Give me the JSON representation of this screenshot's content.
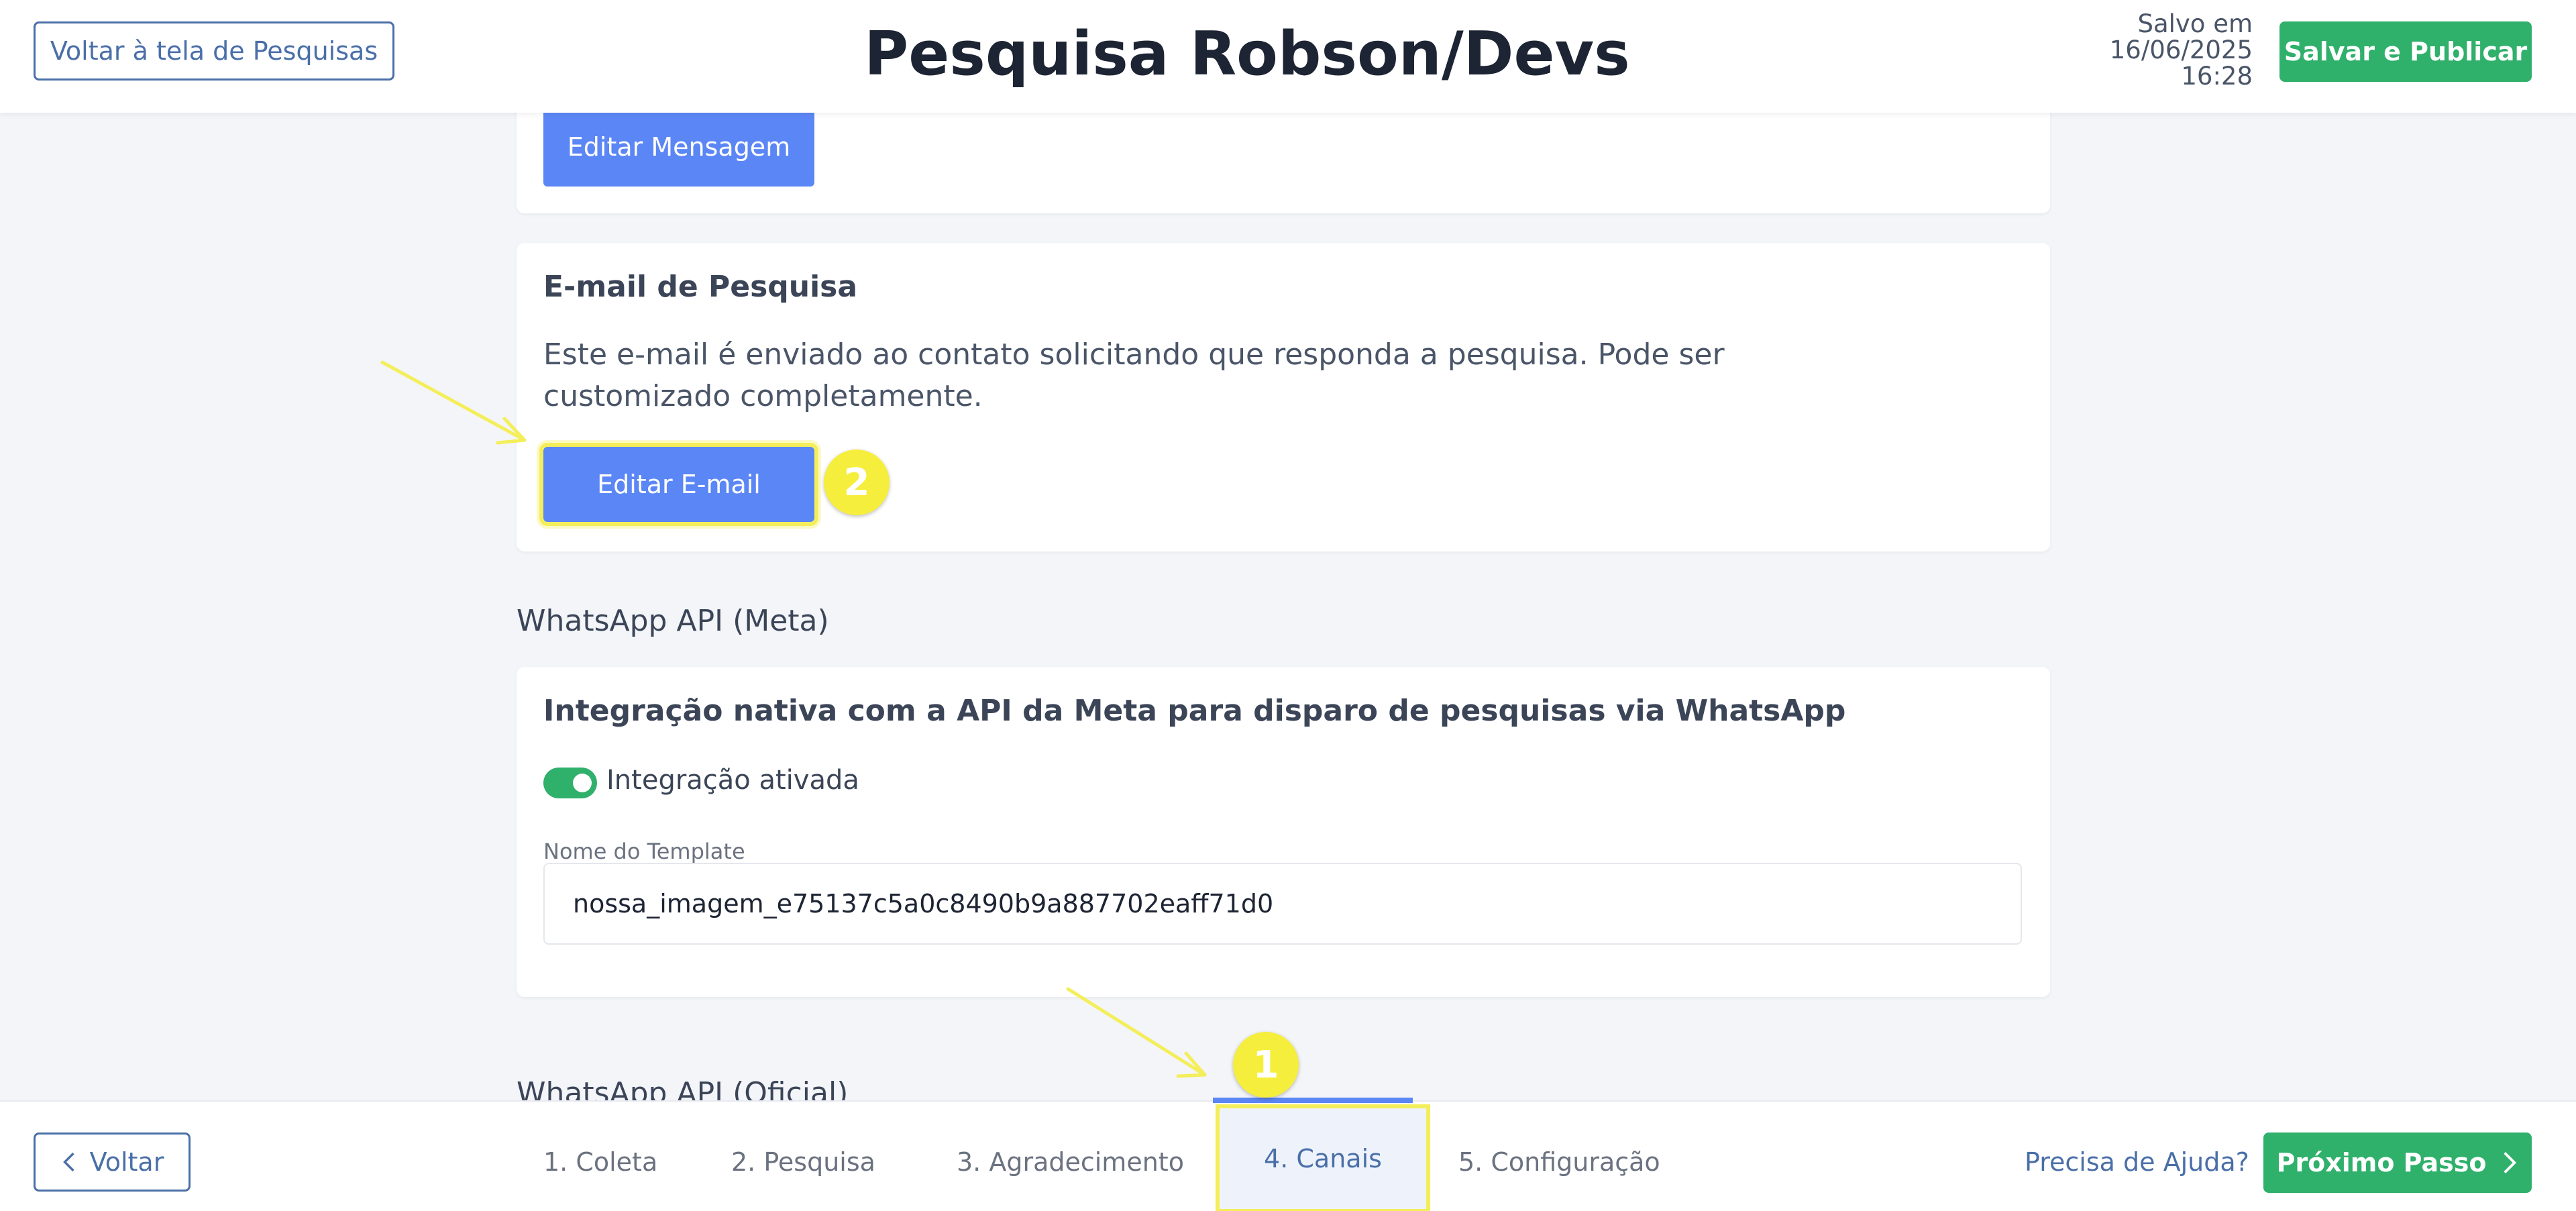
{
  "header": {
    "back_to_list_label": "Voltar à tela de Pesquisas",
    "title": "Pesquisa Robson/Devs",
    "saved_line1": "Salvo em",
    "saved_line2": "16/06/2025",
    "saved_line3": "16:28",
    "publish_label": "Salvar e Publicar"
  },
  "message_card": {
    "edit_message_label": "Editar Mensagem"
  },
  "email_card": {
    "heading": "E-mail de Pesquisa",
    "description": "Este e-mail é enviado ao contato solicitando que responda a pesquisa. Pode ser customizado completamente.",
    "edit_email_label": "Editar E-mail"
  },
  "whatsapp_meta": {
    "section_label": "WhatsApp API (Meta)",
    "heading": "Integração nativa com a API da Meta para disparo de pesquisas via WhatsApp",
    "toggle_label": "Integração ativada",
    "toggle_on": true,
    "template_field_label": "Nome do Template",
    "template_value": "nossa_imagem_e75137c5a0c8490b9a887702eaff71d0"
  },
  "whatsapp_official": {
    "section_label": "WhatsApp API (Oficial)"
  },
  "annotations": {
    "marker_1": "1",
    "marker_2": "2"
  },
  "footer": {
    "back_label": "Voltar",
    "steps": [
      {
        "label": "1. Coleta",
        "active": false
      },
      {
        "label": "2. Pesquisa",
        "active": false
      },
      {
        "label": "3. Agradecimento",
        "active": false
      },
      {
        "label": "4. Canais",
        "active": true
      },
      {
        "label": "5. Configuração",
        "active": false
      }
    ],
    "help_label": "Precisa de Ajuda?",
    "next_label": "Próximo Passo"
  },
  "colors": {
    "primary_green": "#2fb06b",
    "primary_blue": "#5b86f5",
    "outline_blue": "#4a6fa8",
    "highlight_yellow": "#f6ee3c",
    "background": "#f3f5f9"
  },
  "icons": {
    "title_edit": "pencil-icon",
    "back": "chevron-left-icon",
    "next": "chevron-right-icon"
  }
}
